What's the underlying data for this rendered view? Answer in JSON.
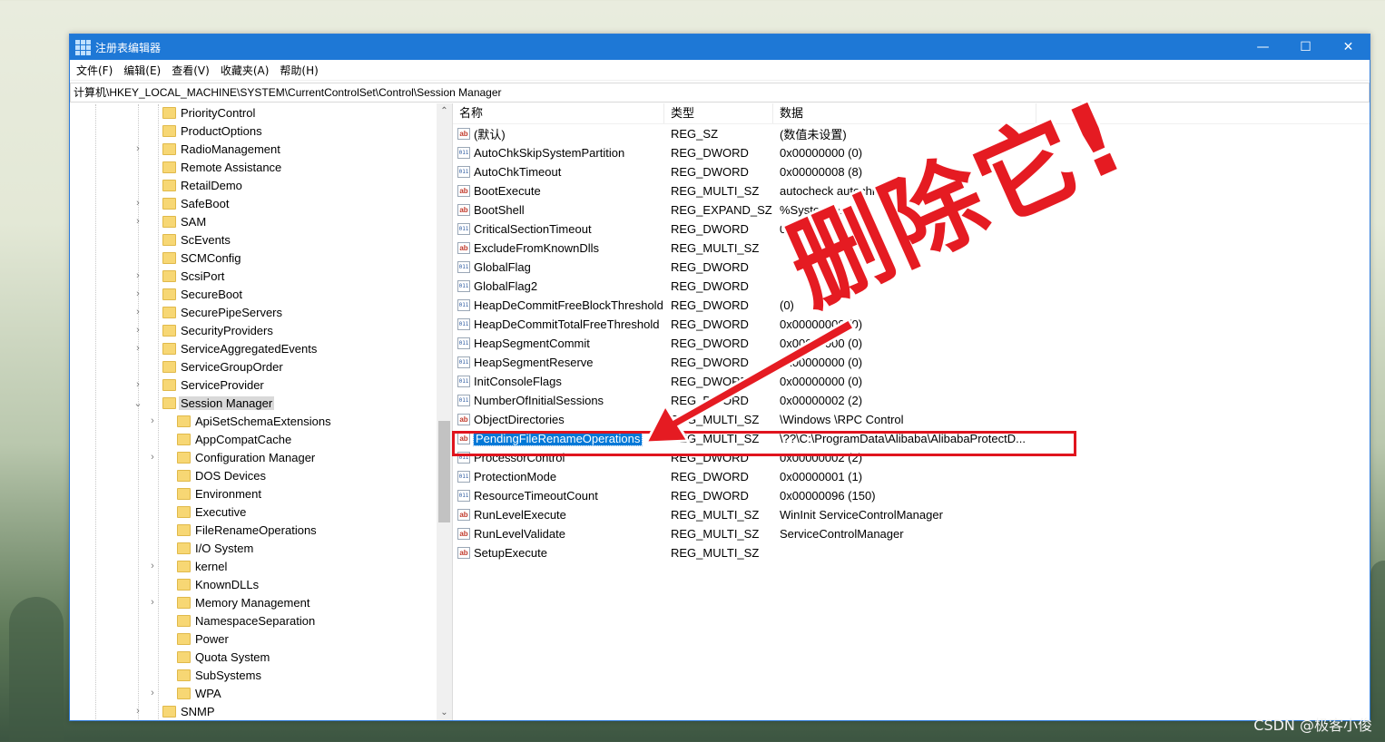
{
  "window": {
    "title": "注册表编辑器",
    "minimize": "—",
    "maximize": "☐",
    "close": "✕"
  },
  "menu": [
    "文件(F)",
    "编辑(E)",
    "查看(V)",
    "收藏夹(A)",
    "帮助(H)"
  ],
  "address": "计算机\\HKEY_LOCAL_MACHINE\\SYSTEM\\CurrentControlSet\\Control\\Session Manager",
  "tree": [
    {
      "label": "PriorityControl",
      "level": 1,
      "expandable": false
    },
    {
      "label": "ProductOptions",
      "level": 1,
      "expandable": false
    },
    {
      "label": "RadioManagement",
      "level": 1,
      "expandable": true
    },
    {
      "label": "Remote Assistance",
      "level": 1,
      "expandable": false
    },
    {
      "label": "RetailDemo",
      "level": 1,
      "expandable": false
    },
    {
      "label": "SafeBoot",
      "level": 1,
      "expandable": true
    },
    {
      "label": "SAM",
      "level": 1,
      "expandable": true
    },
    {
      "label": "ScEvents",
      "level": 1,
      "expandable": false
    },
    {
      "label": "SCMConfig",
      "level": 1,
      "expandable": false
    },
    {
      "label": "ScsiPort",
      "level": 1,
      "expandable": true
    },
    {
      "label": "SecureBoot",
      "level": 1,
      "expandable": true
    },
    {
      "label": "SecurePipeServers",
      "level": 1,
      "expandable": true
    },
    {
      "label": "SecurityProviders",
      "level": 1,
      "expandable": true
    },
    {
      "label": "ServiceAggregatedEvents",
      "level": 1,
      "expandable": true
    },
    {
      "label": "ServiceGroupOrder",
      "level": 1,
      "expandable": false
    },
    {
      "label": "ServiceProvider",
      "level": 1,
      "expandable": true
    },
    {
      "label": "Session Manager",
      "level": 1,
      "expandable": true,
      "expanded": true,
      "selected": true
    },
    {
      "label": "ApiSetSchemaExtensions",
      "level": 2,
      "expandable": true
    },
    {
      "label": "AppCompatCache",
      "level": 2,
      "expandable": false
    },
    {
      "label": "Configuration Manager",
      "level": 2,
      "expandable": true
    },
    {
      "label": "DOS Devices",
      "level": 2,
      "expandable": false
    },
    {
      "label": "Environment",
      "level": 2,
      "expandable": false
    },
    {
      "label": "Executive",
      "level": 2,
      "expandable": false
    },
    {
      "label": "FileRenameOperations",
      "level": 2,
      "expandable": false
    },
    {
      "label": "I/O System",
      "level": 2,
      "expandable": false
    },
    {
      "label": "kernel",
      "level": 2,
      "expandable": true
    },
    {
      "label": "KnownDLLs",
      "level": 2,
      "expandable": false
    },
    {
      "label": "Memory Management",
      "level": 2,
      "expandable": true
    },
    {
      "label": "NamespaceSeparation",
      "level": 2,
      "expandable": false
    },
    {
      "label": "Power",
      "level": 2,
      "expandable": false
    },
    {
      "label": "Quota System",
      "level": 2,
      "expandable": false
    },
    {
      "label": "SubSystems",
      "level": 2,
      "expandable": false
    },
    {
      "label": "WPA",
      "level": 2,
      "expandable": true
    },
    {
      "label": "SNMP",
      "level": 1,
      "expandable": true
    }
  ],
  "list": {
    "headers": [
      "名称",
      "类型",
      "数据"
    ],
    "rows": [
      {
        "name": "(默认)",
        "type": "REG_SZ",
        "data": "(数值未设置)",
        "icon": "sz"
      },
      {
        "name": "AutoChkSkipSystemPartition",
        "type": "REG_DWORD",
        "data": "0x00000000 (0)",
        "icon": "dw"
      },
      {
        "name": "AutoChkTimeout",
        "type": "REG_DWORD",
        "data": "0x00000008 (8)",
        "icon": "dw"
      },
      {
        "name": "BootExecute",
        "type": "REG_MULTI_SZ",
        "data": "autocheck autochk *",
        "icon": "sz"
      },
      {
        "name": "BootShell",
        "type": "REG_EXPAND_SZ",
        "data": "%SystemRo",
        "icon": "sz"
      },
      {
        "name": "CriticalSectionTimeout",
        "type": "REG_DWORD",
        "data": "0x0",
        "icon": "dw"
      },
      {
        "name": "ExcludeFromKnownDlls",
        "type": "REG_MULTI_SZ",
        "data": "",
        "icon": "sz"
      },
      {
        "name": "GlobalFlag",
        "type": "REG_DWORD",
        "data": "",
        "icon": "dw"
      },
      {
        "name": "GlobalFlag2",
        "type": "REG_DWORD",
        "data": "",
        "icon": "dw"
      },
      {
        "name": "HeapDeCommitFreeBlockThreshold",
        "type": "REG_DWORD",
        "data": "(0)",
        "icon": "dw"
      },
      {
        "name": "HeapDeCommitTotalFreeThreshold",
        "type": "REG_DWORD",
        "data": "0x00000000 (0)",
        "icon": "dw"
      },
      {
        "name": "HeapSegmentCommit",
        "type": "REG_DWORD",
        "data": "0x00000000 (0)",
        "icon": "dw"
      },
      {
        "name": "HeapSegmentReserve",
        "type": "REG_DWORD",
        "data": "0x00000000 (0)",
        "icon": "dw"
      },
      {
        "name": "InitConsoleFlags",
        "type": "REG_DWORD",
        "data": "0x00000000 (0)",
        "icon": "dw"
      },
      {
        "name": "NumberOfInitialSessions",
        "type": "REG_DWORD",
        "data": "0x00000002 (2)",
        "icon": "dw"
      },
      {
        "name": "ObjectDirectories",
        "type": "REG_MULTI_SZ",
        "data": "\\Windows \\RPC Control",
        "icon": "sz"
      },
      {
        "name": "PendingFileRenameOperations",
        "type": "REG_MULTI_SZ",
        "data": "\\??\\C:\\ProgramData\\Alibaba\\AlibabaProtectD...",
        "icon": "sz",
        "selected": true
      },
      {
        "name": "ProcessorControl",
        "type": "REG_DWORD",
        "data": "0x00000002 (2)",
        "icon": "dw"
      },
      {
        "name": "ProtectionMode",
        "type": "REG_DWORD",
        "data": "0x00000001 (1)",
        "icon": "dw"
      },
      {
        "name": "ResourceTimeoutCount",
        "type": "REG_DWORD",
        "data": "0x00000096 (150)",
        "icon": "dw"
      },
      {
        "name": "RunLevelExecute",
        "type": "REG_MULTI_SZ",
        "data": "WinInit ServiceControlManager",
        "icon": "sz"
      },
      {
        "name": "RunLevelValidate",
        "type": "REG_MULTI_SZ",
        "data": "ServiceControlManager",
        "icon": "sz"
      },
      {
        "name": "SetupExecute",
        "type": "REG_MULTI_SZ",
        "data": "",
        "icon": "sz"
      }
    ]
  },
  "annotation": {
    "text": "删除它!",
    "color": "#e51b22"
  },
  "watermark": "CSDN @极客小俊",
  "colors": {
    "titlebar": "#1e78d6",
    "selection": "#0078d7",
    "highlight_box": "#e0141e"
  }
}
